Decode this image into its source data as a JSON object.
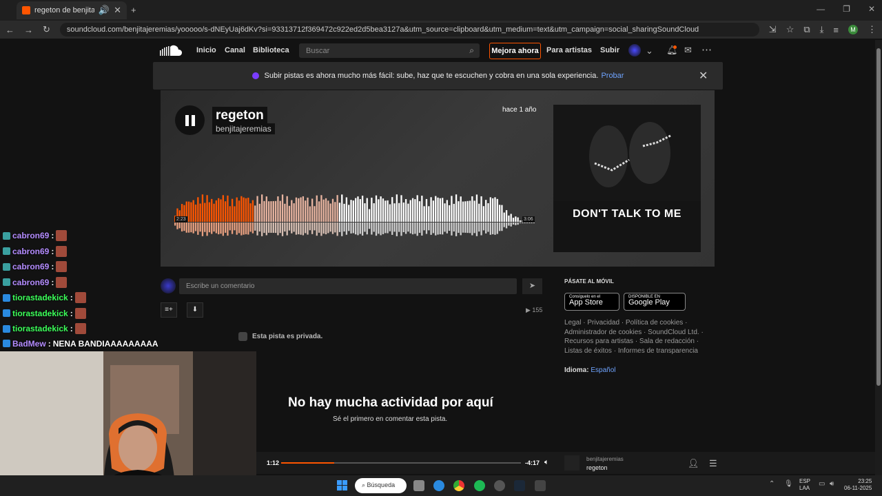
{
  "browser": {
    "tab_title": "regeton de benjitajeremias",
    "url": "soundcloud.com/benjitajeremias/yooooo/s-dNEyUaj6dKv?si=93313712f369472c922ed2d5bea3127a&utm_source=clipboard&utm_medium=text&utm_campaign=social_sharingSoundCloud",
    "profile_initial": "M"
  },
  "nav": {
    "inicio": "Inicio",
    "canal": "Canal",
    "biblioteca": "Biblioteca",
    "search_placeholder": "Buscar",
    "mejora": "Mejora ahora",
    "para_artistas": "Para artistas",
    "subir": "Subir"
  },
  "banner": {
    "text": "Subir pistas es ahora mucho más fácil: sube, haz que te escuchen y cobra en una sola experiencia.",
    "link": "Probar"
  },
  "track": {
    "title": "regeton",
    "artist": "benjitajeremias",
    "age": "hace 1 año",
    "artwork_text": "DON'T TALK TO ME",
    "time_start": "2:23",
    "time_end": "3:06",
    "progress_fraction": 0.45
  },
  "comments": {
    "placeholder": "Escribe un comentario",
    "plays": "155",
    "private_text": "Esta pista es privada.",
    "empty_title": "No hay mucha actividad por aquí",
    "empty_sub": "Sé el primero en comentar esta pista."
  },
  "sidebar": {
    "movil": "PÁSATE AL MÓVIL",
    "appstore_small": "Consíguelo en el",
    "appstore": "App Store",
    "googleplay_small": "DISPONIBLE EN",
    "googleplay": "Google Play",
    "links": "Legal · Privacidad · Política de cookies · Administrador de cookies · SoundCloud Ltd. · Recursos para artistas · Sala de redacción · Listas de éxitos · Informes de transparencia",
    "idioma_label": "Idioma:",
    "idioma_value": "Español"
  },
  "player": {
    "elapsed": "1:12",
    "remaining": "-4:17",
    "artist": "benjitajeremias",
    "title": "regeton",
    "progress_fraction": 0.22
  },
  "chat": [
    {
      "user": "cabron69",
      "msg": "",
      "color": "#b48cff"
    },
    {
      "user": "cabron69",
      "msg": "",
      "color": "#b48cff"
    },
    {
      "user": "cabron69",
      "msg": "",
      "color": "#b48cff"
    },
    {
      "user": "cabron69",
      "msg": "",
      "color": "#b48cff"
    },
    {
      "user": "tiorastadekick",
      "msg": "",
      "color": "#3cff5a"
    },
    {
      "user": "tiorastadekick",
      "msg": "",
      "color": "#3cff5a"
    },
    {
      "user": "tiorastadekick",
      "msg": "",
      "color": "#3cff5a"
    },
    {
      "user": "BadMew",
      "msg": "NENA BANDIAAAAAAAAA",
      "color": "#b48cff"
    }
  ],
  "taskbar": {
    "search": "Búsqueda",
    "lang1": "ESP",
    "lang2": "LAA",
    "time": "23:25",
    "date": "06-11-2025"
  }
}
